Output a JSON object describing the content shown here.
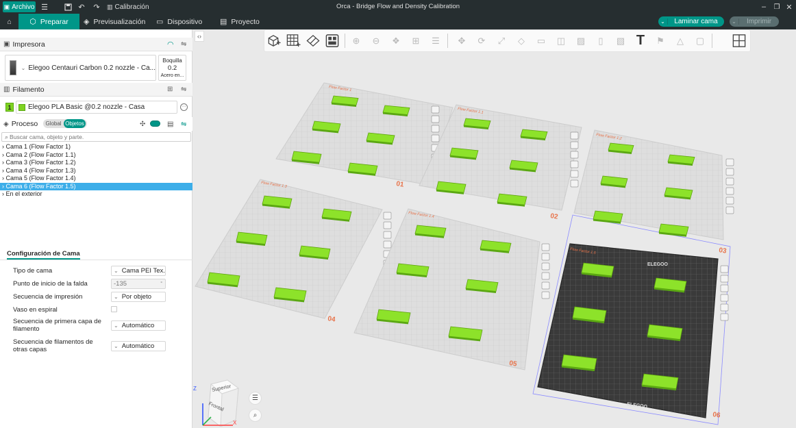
{
  "titlebar": {
    "archivo_label": "Archivo",
    "calibration_label": "Calibración",
    "window_title": "Orca - Bridge Flow and Density Calibration"
  },
  "tabs": {
    "preparar": "Preparar",
    "previsualizacion": "Previsualización",
    "dispositivo": "Dispositivo",
    "proyecto": "Proyecto",
    "laminar": "Laminar cama",
    "imprimir": "Imprimir"
  },
  "printer": {
    "section_label": "Impresora",
    "name": "Elegoo Centauri Carbon 0.2 nozzle - Ca...",
    "nozzle_label": "Boquilla",
    "nozzle_value": "0.2",
    "nozzle_material": "Acero en..."
  },
  "filament": {
    "section_label": "Filamento",
    "slot": "1",
    "name": "Elegoo PLA Basic @0.2 nozzle - Casa",
    "color": "#7ed321"
  },
  "process": {
    "section_label": "Proceso",
    "toggle_global": "Global",
    "toggle_objects": "Objetos",
    "search_placeholder": "Buscar cama, objeto y parte."
  },
  "tree": [
    {
      "label": "Cama 1 (Flow Factor 1)",
      "selected": false
    },
    {
      "label": "Cama 2 (Flow Factor 1.1)",
      "selected": false
    },
    {
      "label": "Cama 3 (Flow Factor 1.2)",
      "selected": false
    },
    {
      "label": "Cama 4 (Flow Factor 1.3)",
      "selected": false
    },
    {
      "label": "Cama 5 (Flow Factor 1.4)",
      "selected": false
    },
    {
      "label": "Cama 6 (Flow Factor 1.5)",
      "selected": true
    },
    {
      "label": "En el exterior",
      "selected": false
    }
  ],
  "bed_config": {
    "title": "Configuración de Cama",
    "rows": [
      {
        "label": "Tipo de cama",
        "value": "Cama PEI Tex..."
      },
      {
        "label": "Punto de inicio de la falda",
        "value": "-135"
      },
      {
        "label": "Secuencia de impresión",
        "value": "Por objeto"
      },
      {
        "label": "Vaso en espiral",
        "value": ""
      },
      {
        "label": "Secuencia de primera capa de filamento",
        "value": "Automático"
      },
      {
        "label": "Secuencia de filamentos de otras capas",
        "value": "Automático"
      }
    ]
  },
  "plates": [
    {
      "num": "01",
      "title": "Flow Factor 1"
    },
    {
      "num": "02",
      "title": "Flow Factor 1.1"
    },
    {
      "num": "03",
      "title": "Flow Factor 1.2"
    },
    {
      "num": "04",
      "title": "Flow Factor 1.3"
    },
    {
      "num": "05",
      "title": "Flow Factor 1.4"
    },
    {
      "num": "06",
      "title": "Flow Factor 1.5"
    }
  ],
  "viewcube": {
    "top": "Superior",
    "front": "Frontal",
    "axis_x": "X",
    "axis_z": "Z"
  },
  "bed_brand": "ELEGOO",
  "colors": {
    "accent": "#009688",
    "dark_bar": "#262e30",
    "selection": "#3daee9",
    "object_green": "#8de22a",
    "plate_number": "#e8734a"
  }
}
